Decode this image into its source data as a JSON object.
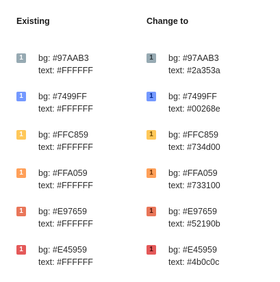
{
  "columns": [
    {
      "title": "Existing",
      "rows": [
        {
          "badge": "1",
          "bg": "#97AAB3",
          "fg": "#FFFFFF",
          "bg_text": "bg: #97AAB3",
          "fg_text": "text: #FFFFFF"
        },
        {
          "badge": "1",
          "bg": "#7499FF",
          "fg": "#FFFFFF",
          "bg_text": "bg: #7499FF",
          "fg_text": "text: #FFFFFF"
        },
        {
          "badge": "1",
          "bg": "#FFC859",
          "fg": "#FFFFFF",
          "bg_text": "bg: #FFC859",
          "fg_text": "text: #FFFFFF"
        },
        {
          "badge": "1",
          "bg": "#FFA059",
          "fg": "#FFFFFF",
          "bg_text": "bg: #FFA059",
          "fg_text": "text: #FFFFFF"
        },
        {
          "badge": "1",
          "bg": "#E97659",
          "fg": "#FFFFFF",
          "bg_text": "bg: #E97659",
          "fg_text": "text: #FFFFFF"
        },
        {
          "badge": "1",
          "bg": "#E45959",
          "fg": "#FFFFFF",
          "bg_text": "bg: #E45959",
          "fg_text": "text: #FFFFFF"
        }
      ]
    },
    {
      "title": "Change to",
      "rows": [
        {
          "badge": "1",
          "bg": "#97AAB3",
          "fg": "#2a353a",
          "bg_text": "bg: #97AAB3",
          "fg_text": "text: #2a353a"
        },
        {
          "badge": "1",
          "bg": "#7499FF",
          "fg": "#00268e",
          "bg_text": "bg: #7499FF",
          "fg_text": "text: #00268e"
        },
        {
          "badge": "1",
          "bg": "#FFC859",
          "fg": "#734d00",
          "bg_text": "bg: #FFC859",
          "fg_text": "text: #734d00"
        },
        {
          "badge": "1",
          "bg": "#FFA059",
          "fg": "#733100",
          "bg_text": "bg: #FFA059",
          "fg_text": "text: #733100"
        },
        {
          "badge": "1",
          "bg": "#E97659",
          "fg": "#52190b",
          "bg_text": "bg: #E97659",
          "fg_text": "text: #52190b"
        },
        {
          "badge": "1",
          "bg": "#E45959",
          "fg": "#4b0c0c",
          "bg_text": "bg: #E45959",
          "fg_text": "text: #4b0c0c"
        }
      ]
    }
  ]
}
